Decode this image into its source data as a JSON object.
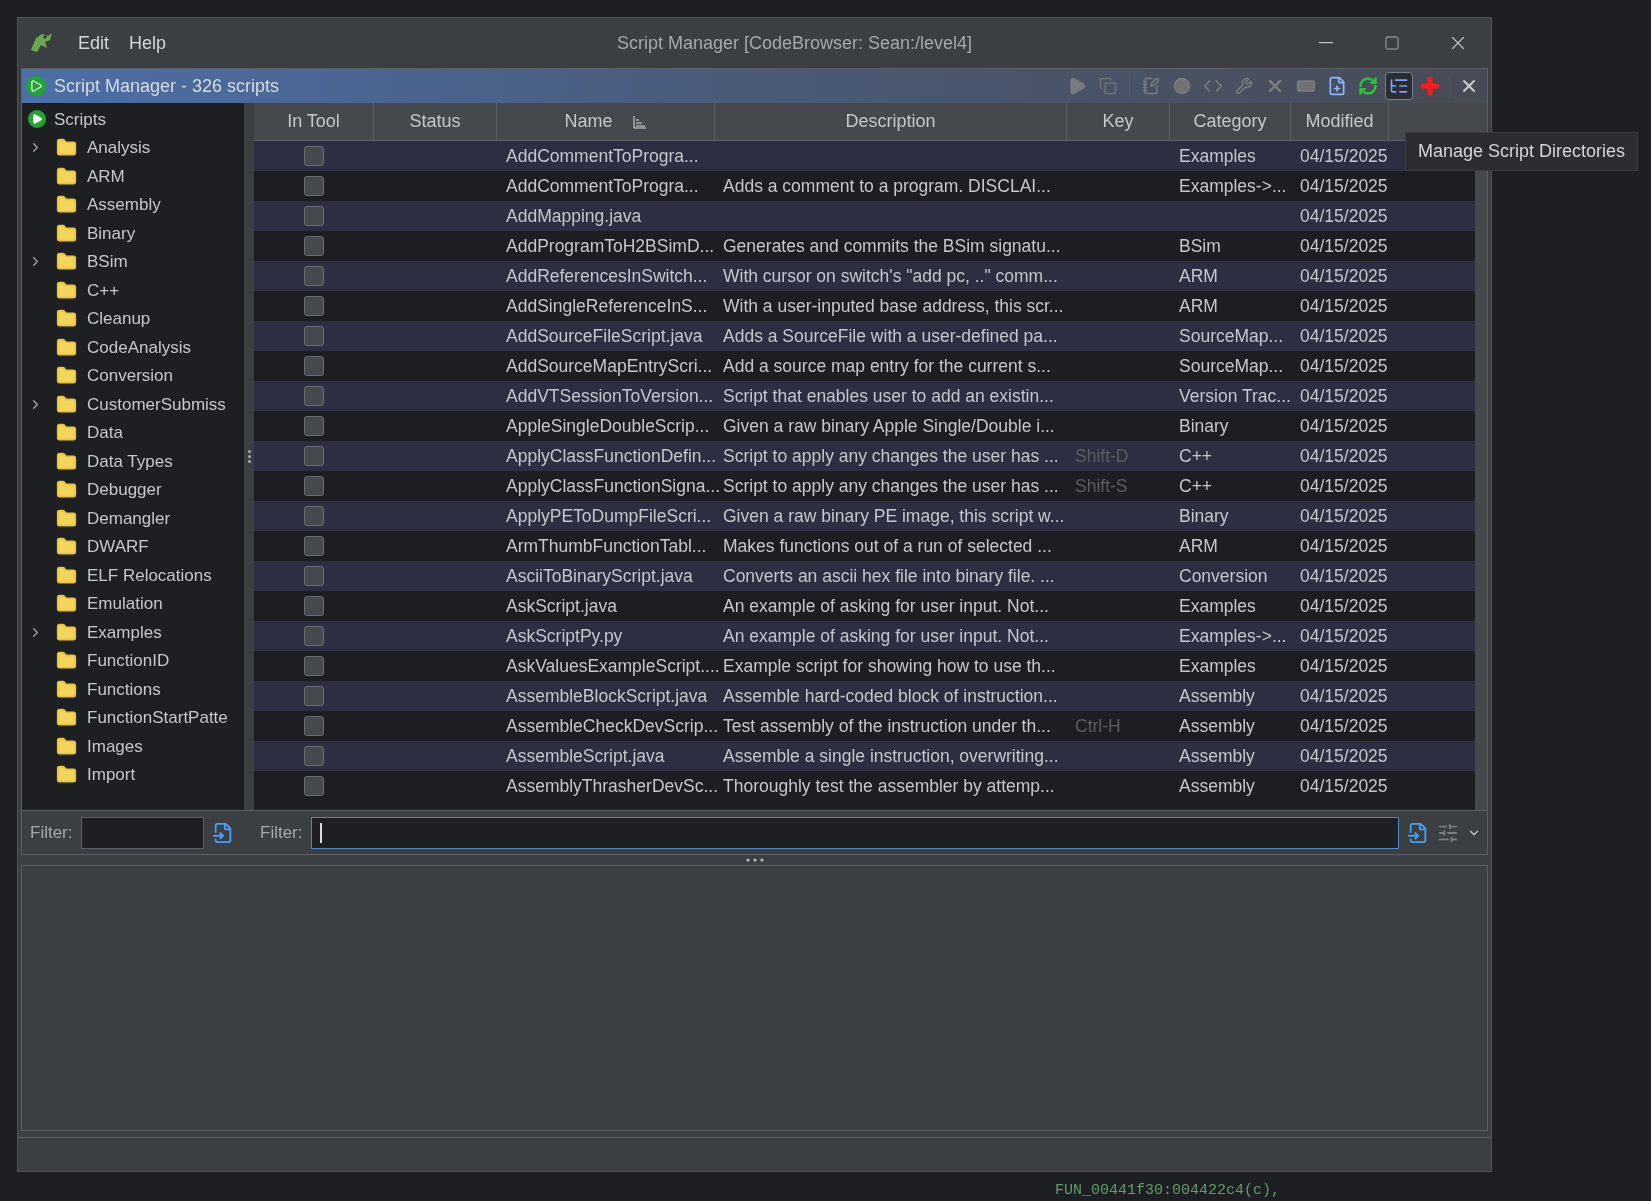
{
  "window": {
    "menu": [
      "Edit",
      "Help"
    ],
    "title": "Script Manager [CodeBrowser: Sean:/level4]"
  },
  "panel": {
    "title": "Script Manager - 326 scripts",
    "tooltip": "Manage Script Directories"
  },
  "tree": {
    "label": "Scripts",
    "children": [
      {
        "label": "Analysis",
        "expandable": true
      },
      {
        "label": "ARM",
        "expandable": false
      },
      {
        "label": "Assembly",
        "expandable": false
      },
      {
        "label": "Binary",
        "expandable": false
      },
      {
        "label": "BSim",
        "expandable": true
      },
      {
        "label": "C++",
        "expandable": false
      },
      {
        "label": "Cleanup",
        "expandable": false
      },
      {
        "label": "CodeAnalysis",
        "expandable": false
      },
      {
        "label": "Conversion",
        "expandable": false
      },
      {
        "label": "CustomerSubmiss",
        "expandable": true
      },
      {
        "label": "Data",
        "expandable": false
      },
      {
        "label": "Data Types",
        "expandable": false
      },
      {
        "label": "Debugger",
        "expandable": false
      },
      {
        "label": "Demangler",
        "expandable": false
      },
      {
        "label": "DWARF",
        "expandable": false
      },
      {
        "label": "ELF Relocations",
        "expandable": false
      },
      {
        "label": "Emulation",
        "expandable": false
      },
      {
        "label": "Examples",
        "expandable": true
      },
      {
        "label": "FunctionID",
        "expandable": false
      },
      {
        "label": "Functions",
        "expandable": false
      },
      {
        "label": "FunctionStartPatte",
        "expandable": false
      },
      {
        "label": "Images",
        "expandable": false
      },
      {
        "label": "Import",
        "expandable": false
      }
    ]
  },
  "table": {
    "columns": [
      "In Tool",
      "Status",
      "Name",
      "Description",
      "Key",
      "Category",
      "Modified"
    ],
    "rows": [
      {
        "in_tool": false,
        "name": "AddCommentToProgra...",
        "description": "",
        "key": "",
        "category": "Examples",
        "modified": "04/15/2025"
      },
      {
        "in_tool": false,
        "name": "AddCommentToProgra...",
        "description": "Adds a comment to a program. DISCLAI...",
        "key": "",
        "category": "Examples->...",
        "modified": "04/15/2025"
      },
      {
        "in_tool": false,
        "name": "AddMapping.java",
        "description": "",
        "key": "",
        "category": "",
        "modified": "04/15/2025"
      },
      {
        "in_tool": false,
        "name": "AddProgramToH2BSimD...",
        "description": "Generates and commits the BSim signatu...",
        "key": "",
        "category": "BSim",
        "modified": "04/15/2025"
      },
      {
        "in_tool": false,
        "name": "AddReferencesInSwitch...",
        "description": "With cursor on switch's \"add pc, ..\" comm...",
        "key": "",
        "category": "ARM",
        "modified": "04/15/2025"
      },
      {
        "in_tool": false,
        "name": "AddSingleReferenceInS...",
        "description": "With a user-inputed base address, this scr...",
        "key": "",
        "category": "ARM",
        "modified": "04/15/2025"
      },
      {
        "in_tool": false,
        "name": "AddSourceFileScript.java",
        "description": "Adds a SourceFile with a user-defined pa...",
        "key": "",
        "category": "SourceMap...",
        "modified": "04/15/2025"
      },
      {
        "in_tool": false,
        "name": "AddSourceMapEntryScri...",
        "description": "Add a source map entry for the current s...",
        "key": "",
        "category": "SourceMap...",
        "modified": "04/15/2025"
      },
      {
        "in_tool": false,
        "name": "AddVTSessionToVersion...",
        "description": "Script that enables user to add an existin...",
        "key": "",
        "category": "Version Trac...",
        "modified": "04/15/2025"
      },
      {
        "in_tool": false,
        "name": "AppleSingleDoubleScrip...",
        "description": "Given a raw binary Apple Single/Double i...",
        "key": "",
        "category": "Binary",
        "modified": "04/15/2025"
      },
      {
        "in_tool": false,
        "name": "ApplyClassFunctionDefin...",
        "description": "Script to apply any changes the user has ...",
        "key": "Shift-D",
        "category": "C++",
        "modified": "04/15/2025"
      },
      {
        "in_tool": false,
        "name": "ApplyClassFunctionSigna...",
        "description": "Script to apply any changes the user has ...",
        "key": "Shift-S",
        "category": "C++",
        "modified": "04/15/2025"
      },
      {
        "in_tool": false,
        "name": "ApplyPEToDumpFileScri...",
        "description": "Given a raw binary PE image, this script w...",
        "key": "",
        "category": "Binary",
        "modified": "04/15/2025"
      },
      {
        "in_tool": false,
        "name": "ArmThumbFunctionTabl...",
        "description": "Makes functions out of a run of selected ...",
        "key": "",
        "category": "ARM",
        "modified": "04/15/2025"
      },
      {
        "in_tool": false,
        "name": "AsciiToBinaryScript.java",
        "description": "Converts an ascii hex file into binary file. ...",
        "key": "",
        "category": "Conversion",
        "modified": "04/15/2025"
      },
      {
        "in_tool": false,
        "name": "AskScript.java",
        "description": "An example of asking for user input. Not...",
        "key": "",
        "category": "Examples",
        "modified": "04/15/2025"
      },
      {
        "in_tool": false,
        "name": "AskScriptPy.py",
        "description": "An example of asking for user input. Not...",
        "key": "",
        "category": "Examples->...",
        "modified": "04/15/2025"
      },
      {
        "in_tool": false,
        "name": "AskValuesExampleScript....",
        "description": "Example script for showing how to use th...",
        "key": "",
        "category": "Examples",
        "modified": "04/15/2025"
      },
      {
        "in_tool": false,
        "name": "AssembleBlockScript.java",
        "description": "Assemble hard-coded block of instruction...",
        "key": "",
        "category": "Assembly",
        "modified": "04/15/2025"
      },
      {
        "in_tool": false,
        "name": "AssembleCheckDevScrip...",
        "description": "Test assembly of the instruction under th...",
        "key": "Ctrl-H",
        "category": "Assembly",
        "modified": "04/15/2025"
      },
      {
        "in_tool": false,
        "name": "AssembleScript.java",
        "description": "Assemble a single instruction, overwriting...",
        "key": "",
        "category": "Assembly",
        "modified": "04/15/2025"
      },
      {
        "in_tool": false,
        "name": "AssemblyThrasherDevSc...",
        "description": "Thoroughly test the assembler by attemp...",
        "key": "",
        "category": "Assembly",
        "modified": "04/15/2025"
      }
    ]
  },
  "tree_filter": {
    "label": "Filter:"
  },
  "table_filter": {
    "label": "Filter:"
  },
  "background_code": "FUN_00441f30:004422c4(c),"
}
